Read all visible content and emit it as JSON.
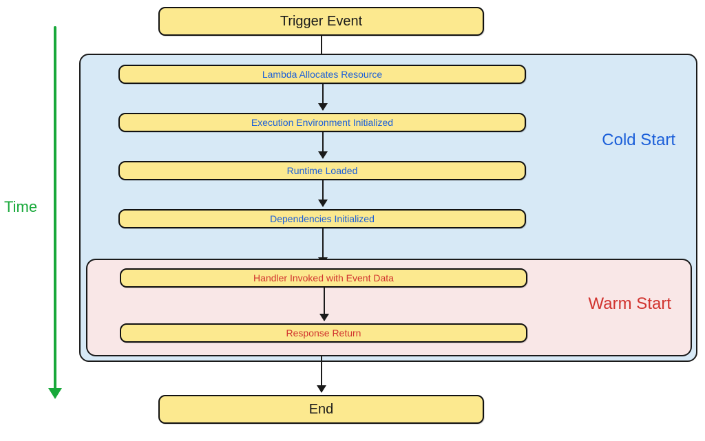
{
  "time_label": "Time",
  "trigger": "Trigger Event",
  "end": "End",
  "cold_start": {
    "label": "Cold Start",
    "steps": {
      "s1": "Lambda Allocates Resource",
      "s2": "Execution Environment Initialized",
      "s3": "Runtime Loaded",
      "s4": "Dependencies Initialized"
    }
  },
  "warm_start": {
    "label": "Warm Start",
    "steps": {
      "s5": "Handler Invoked with Event Data",
      "s6": "Response Return"
    }
  }
}
